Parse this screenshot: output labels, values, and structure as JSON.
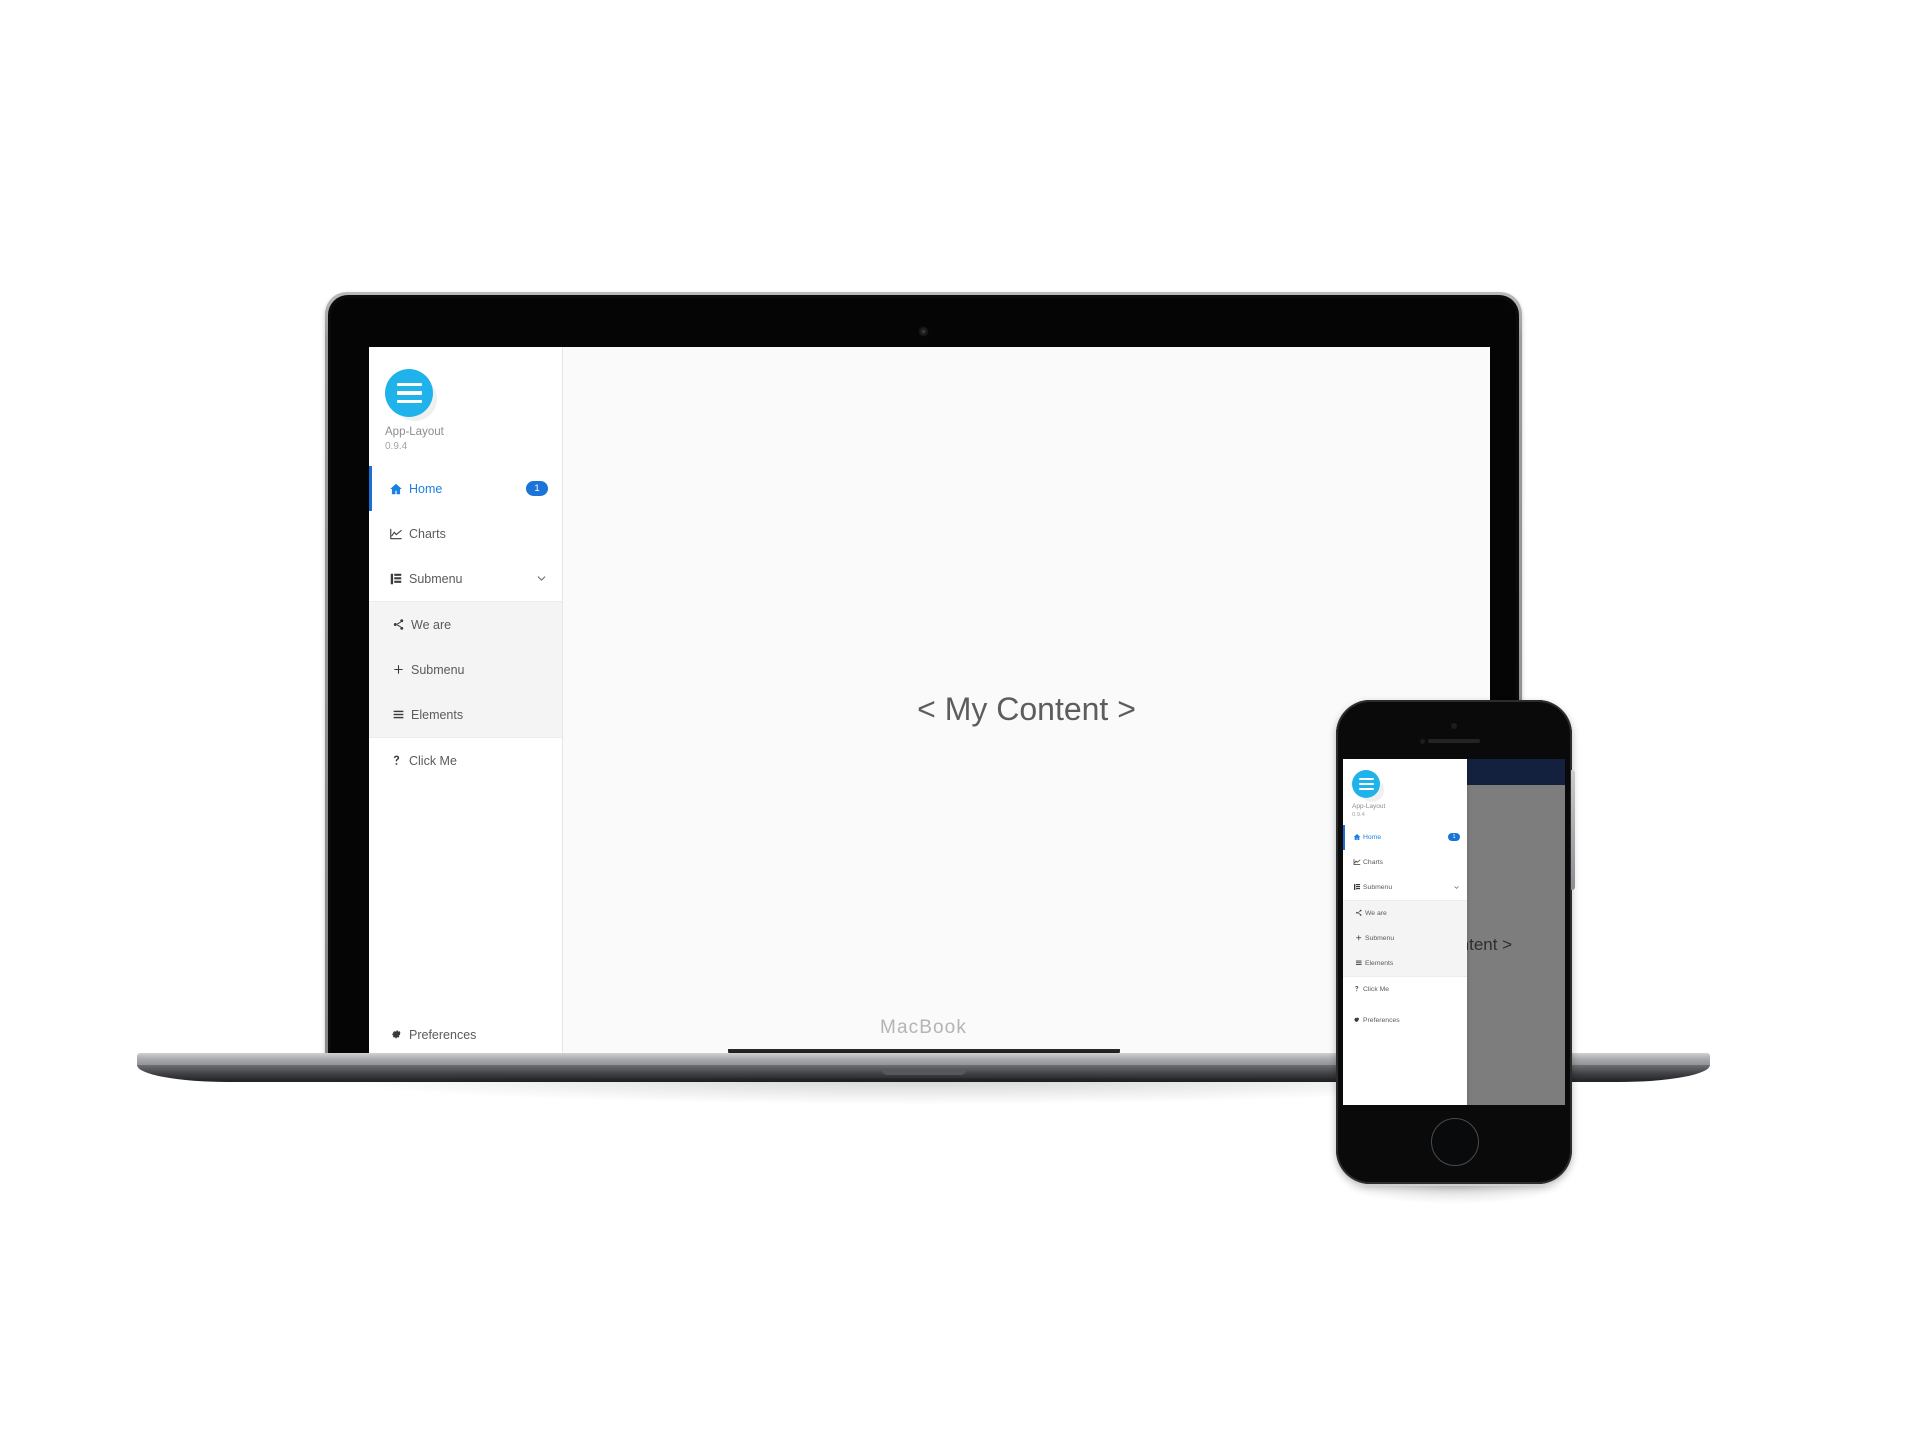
{
  "app": {
    "brand": {
      "logo_icon": "hamburger-menu-logo-icon",
      "name": "App-Layout",
      "version": "0.9.4",
      "logo_color": "#20b2eb"
    },
    "nav": [
      {
        "id": "home",
        "label": "Home",
        "icon": "home-icon",
        "badge": "1",
        "active": true
      },
      {
        "id": "charts",
        "label": "Charts",
        "icon": "chart-line-icon",
        "badge": null,
        "active": false
      },
      {
        "id": "submenu-toggle",
        "label": "Submenu",
        "icon": "list-layers-icon",
        "badge": null,
        "active": false,
        "chevron": "chevron-down-icon"
      }
    ],
    "submenu": [
      {
        "id": "we-are",
        "label": "We are",
        "icon": "share-icon"
      },
      {
        "id": "submenu-child",
        "label": "Submenu",
        "icon": "plus-icon"
      },
      {
        "id": "elements",
        "label": "Elements",
        "icon": "hamburger-icon"
      }
    ],
    "nav_after": [
      {
        "id": "click-me",
        "label": "Click Me",
        "icon": "question-mark-icon"
      }
    ],
    "footer": [
      {
        "id": "preferences",
        "label": "Preferences",
        "icon": "gear-icon"
      }
    ],
    "content": {
      "text": "< My Content >"
    },
    "colors": {
      "accent": "#1b82e2",
      "active_bar": "#1b6fd0",
      "badge": "#1b74d8",
      "submenu_bg": "#f4f4f4",
      "content_bg": "#fafafa",
      "mobile_topbar": "#26437e"
    }
  },
  "devices": {
    "laptop": {
      "label": "MacBook"
    },
    "phone": {
      "label": ""
    }
  }
}
